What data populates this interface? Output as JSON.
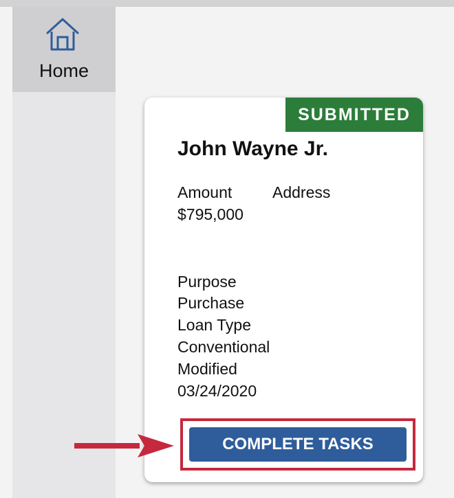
{
  "sidebar": {
    "home_label": "Home",
    "home_icon": "house-icon"
  },
  "card": {
    "status": "SUBMITTED",
    "status_color": "#2c7d3a",
    "name": "John Wayne Jr.",
    "amount_label": "Amount",
    "amount_value": "$795,000",
    "address_label": "Address",
    "purpose_label": "Purpose",
    "purpose_value": "Purchase",
    "loan_type_label": "Loan Type",
    "loan_type_value": "Conventional",
    "modified_label": "Modified",
    "modified_value": "03/24/2020",
    "action_label": "COMPLETE TASKS",
    "action_color": "#2f5d9b",
    "highlight_color": "#c6283d"
  }
}
